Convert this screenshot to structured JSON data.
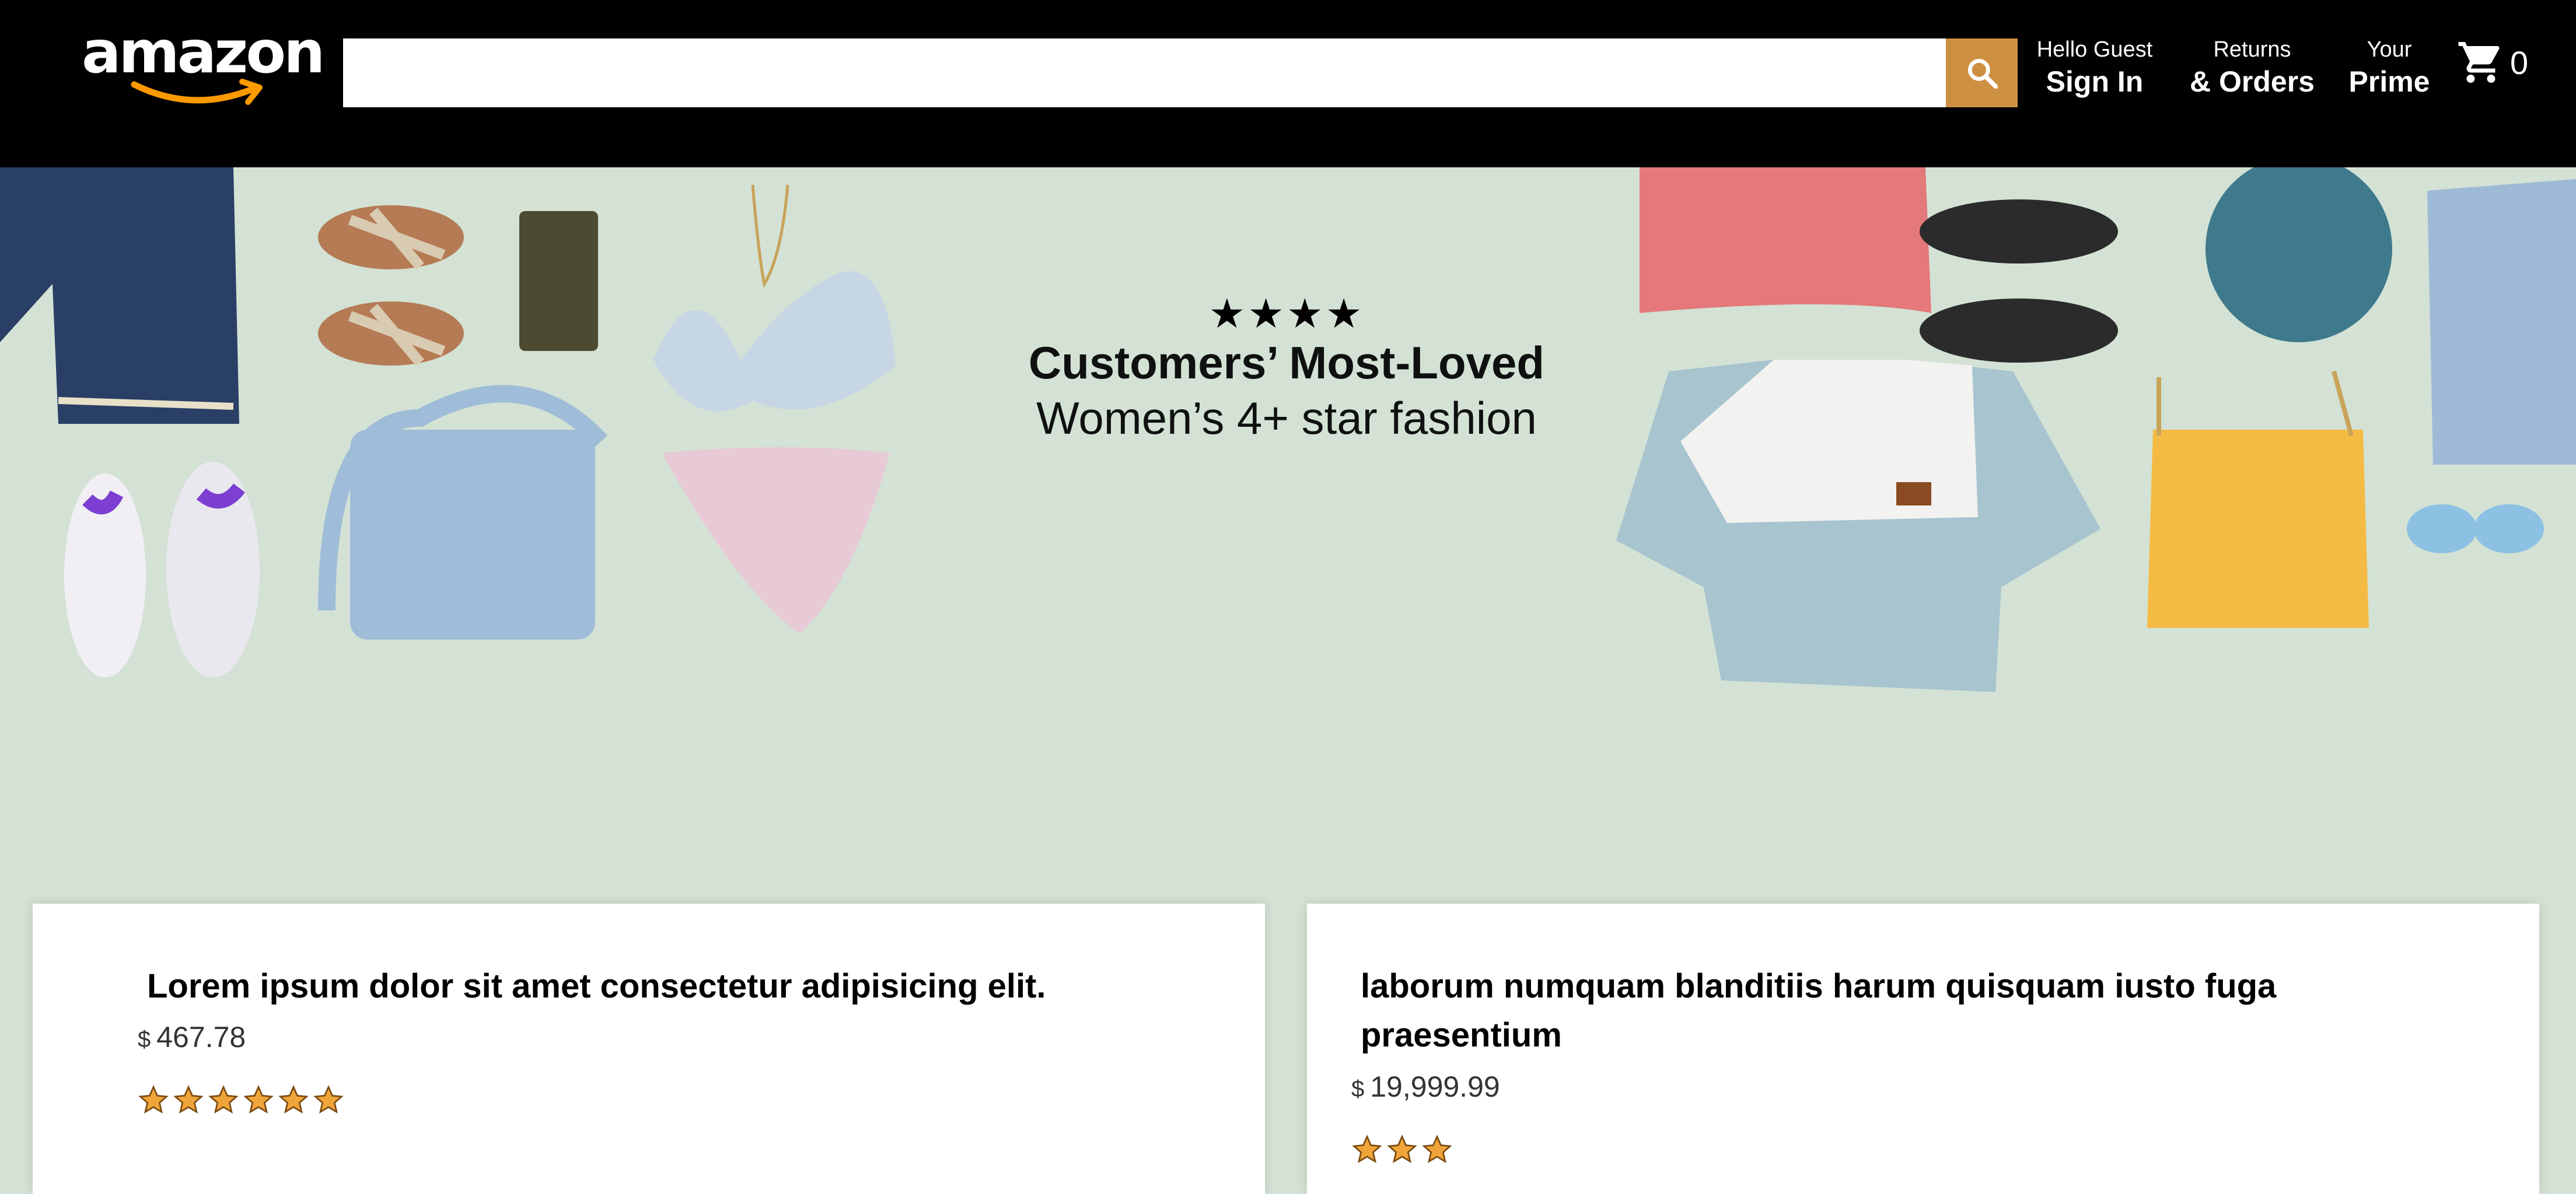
{
  "header": {
    "logo_text": "amazon",
    "search": {
      "value": "",
      "placeholder": ""
    },
    "search_icon": "search-icon",
    "nav": [
      {
        "line1": "Hello Guest",
        "line2": "Sign In"
      },
      {
        "line1": "Returns",
        "line2": "& Orders"
      },
      {
        "line1": "Your",
        "line2": "Prime"
      }
    ],
    "cart": {
      "icon": "cart-icon",
      "count": "0"
    }
  },
  "hero": {
    "stars": "★★★★",
    "title": "Customers’ Most-Loved",
    "subtitle": "Women’s 4+ star fashion"
  },
  "products": [
    {
      "title": "Lorem ipsum dolor sit amet consectetur adipisicing elit.",
      "currency": "$",
      "price": "467.78",
      "rating": 6
    },
    {
      "title": "laborum numquam blanditiis harum quisquam iusto fuga praesentium",
      "currency": "$",
      "price": "19,999.99",
      "rating": 3
    }
  ],
  "colors": {
    "header_bg": "#000000",
    "hero_bg": "#d3e2d4",
    "search_button": "#cd9042",
    "star_fill": "#f0a53a"
  }
}
